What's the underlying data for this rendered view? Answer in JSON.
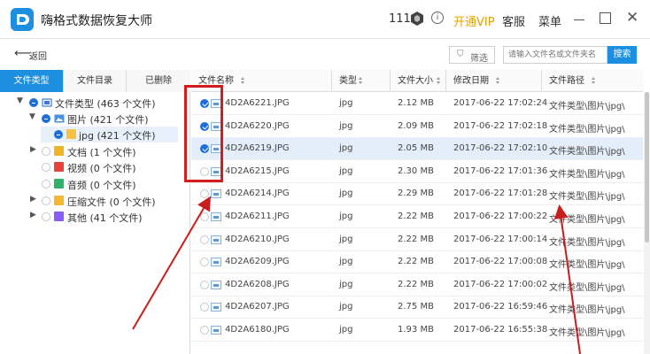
{
  "app": {
    "title": "嗨格式数据恢复大师",
    "credits": "111",
    "vip_label": "开通VIP",
    "service_label": "客服",
    "menu_label": "菜单"
  },
  "icons": {
    "logo": "app-logo-icon",
    "credits": "hexagon-coin-icon",
    "info": "info-icon",
    "back": "back-arrow-icon",
    "filter": "filter-icon",
    "file": "image-file-icon"
  },
  "toolbar": {
    "back_label": "返回",
    "filter_label": "筛选",
    "search_placeholder": "请输入文件名或文件夹名",
    "search_button": "搜索"
  },
  "tabs": [
    "文件类型",
    "文件目录",
    "已删除"
  ],
  "tree": [
    {
      "label": "文件类型 (463 个文件)"
    },
    {
      "label": "图片 (421 个文件)"
    },
    {
      "label": "jpg (421 个文件)"
    },
    {
      "label": "文档 (1 个文件)"
    },
    {
      "label": "视频 (0 个文件)"
    },
    {
      "label": "音频 (0 个文件)"
    },
    {
      "label": "压缩文件 (0 个文件)"
    },
    {
      "label": "其他 (41 个文件)"
    }
  ],
  "columns": [
    "文件名称",
    "类型",
    "文件大小",
    "修改日期",
    "文件路径"
  ],
  "rows": [
    {
      "name": "4D2A6221.JPG",
      "type": "jpg",
      "size": "2.12 MB",
      "date": "2017-06-22 17:02:24",
      "path": "文件类型\\图片\\jpg\\",
      "checked": true
    },
    {
      "name": "4D2A6220.JPG",
      "type": "jpg",
      "size": "2.09 MB",
      "date": "2017-06-22 17:02:18",
      "path": "文件类型\\图片\\jpg\\",
      "checked": true
    },
    {
      "name": "4D2A6219.JPG",
      "type": "jpg",
      "size": "2.05 MB",
      "date": "2017-06-22 17:02:10",
      "path": "文件类型\\图片\\jpg\\",
      "checked": true
    },
    {
      "name": "4D2A6215.JPG",
      "type": "jpg",
      "size": "2.30 MB",
      "date": "2017-06-22 17:01:36",
      "path": "文件类型\\图片\\jpg\\",
      "checked": false
    },
    {
      "name": "4D2A6214.JPG",
      "type": "jpg",
      "size": "2.29 MB",
      "date": "2017-06-22 17:01:28",
      "path": "文件类型\\图片\\jpg\\",
      "checked": false
    },
    {
      "name": "4D2A6211.JPG",
      "type": "jpg",
      "size": "2.22 MB",
      "date": "2017-06-22 17:00:22",
      "path": "文件类型\\图片\\jpg\\",
      "checked": false
    },
    {
      "name": "4D2A6210.JPG",
      "type": "jpg",
      "size": "2.22 MB",
      "date": "2017-06-22 17:00:14",
      "path": "文件类型\\图片\\jpg\\",
      "checked": false
    },
    {
      "name": "4D2A6209.JPG",
      "type": "jpg",
      "size": "2.22 MB",
      "date": "2017-06-22 17:00:08",
      "path": "文件类型\\图片\\jpg\\",
      "checked": false
    },
    {
      "name": "4D2A6208.JPG",
      "type": "jpg",
      "size": "2.22 MB",
      "date": "2017-06-22 17:00:02",
      "path": "文件类型\\图片\\jpg\\",
      "checked": false
    },
    {
      "name": "4D2A6207.JPG",
      "type": "jpg",
      "size": "2.75 MB",
      "date": "2017-06-22 16:59:46",
      "path": "文件类型\\图片\\jpg\\",
      "checked": false
    },
    {
      "name": "4D2A6180.JPG",
      "type": "jpg",
      "size": "1.93 MB",
      "date": "2017-06-22 16:55:38",
      "path": "文件类型\\图片\\jpg\\",
      "checked": false
    }
  ],
  "colors": {
    "accent": "#1d8fe0",
    "vip": "#e6a100",
    "annotation": "#d31d1d",
    "selected_row": "#e3eefa"
  }
}
